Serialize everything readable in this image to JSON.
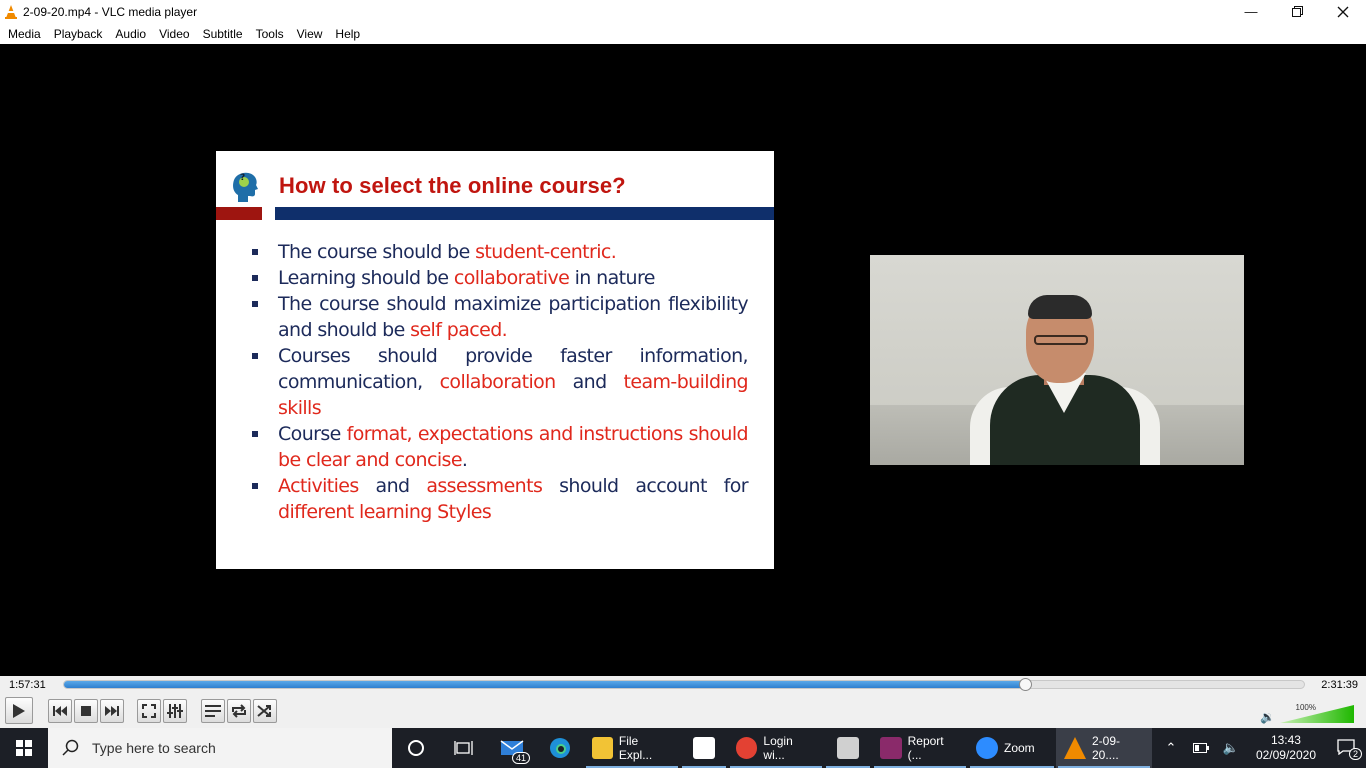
{
  "window": {
    "title": "2-09-20.mp4 - VLC media player",
    "controls": [
      "minimize",
      "restore",
      "close"
    ]
  },
  "menu": [
    "Media",
    "Playback",
    "Audio",
    "Video",
    "Subtitle",
    "Tools",
    "View",
    "Help"
  ],
  "slide": {
    "heading": "How to select the online course?",
    "bullets": [
      [
        {
          "t": "The course should be ",
          "c": "n"
        },
        {
          "t": "student-centric.",
          "c": "r"
        }
      ],
      [
        {
          "t": "Learning should be ",
          "c": "n"
        },
        {
          "t": "collaborative",
          "c": "r"
        },
        {
          "t": " in nature",
          "c": "n"
        }
      ],
      [
        {
          "t": "The course should maximize participation flexibility and should be ",
          "c": "n"
        },
        {
          "t": "self paced.",
          "c": "r"
        }
      ],
      [
        {
          "t": "Courses should provide faster information, communication, ",
          "c": "n"
        },
        {
          "t": "collaboration",
          "c": "r"
        },
        {
          "t": " and ",
          "c": "n"
        },
        {
          "t": "team-building skills",
          "c": "r"
        }
      ],
      [
        {
          "t": "Course ",
          "c": "n"
        },
        {
          "t": "format, expectations and instructions should be clear and concise",
          "c": "r"
        },
        {
          "t": ".",
          "c": "n"
        }
      ],
      [
        {
          "t": "Activities",
          "c": "r"
        },
        {
          "t": " and ",
          "c": "n"
        },
        {
          "t": "assessments",
          "c": "r"
        },
        {
          "t": " should account for ",
          "c": "n"
        },
        {
          "t": "different learning Styles",
          "c": "r"
        }
      ]
    ]
  },
  "player": {
    "elapsed": "1:57:31",
    "total": "2:31:39",
    "progress_fraction": 0.775,
    "volume_label": "100%",
    "volume_fraction": 1.0
  },
  "taskbar": {
    "search_placeholder": "Type here to search",
    "mail_badge": "41",
    "apps": [
      {
        "label": "File Expl...",
        "icon": "folder-icon",
        "color": "#f2c335"
      },
      {
        "label": "",
        "icon": "store-icon",
        "color": "#ffffff"
      },
      {
        "label": "Login wi...",
        "icon": "chrome-icon",
        "color": "#e34133"
      },
      {
        "label": "",
        "icon": "paint-icon",
        "color": "#d0d0d0"
      },
      {
        "label": "Report (...",
        "icon": "winrar-icon",
        "color": "#8a2a6a"
      },
      {
        "label": "Zoom",
        "icon": "zoom-icon",
        "color": "#2d8cff"
      },
      {
        "label": "2-09-20....",
        "icon": "vlc-icon",
        "color": "#f08a00"
      }
    ],
    "time": "13:43",
    "date": "02/09/2020",
    "notifications": "2"
  },
  "colors": {
    "slide_heading": "#c0150f",
    "slide_text": "#1c2a5a",
    "slide_highlight": "#e0281c",
    "seek_fill": "#2f7fcf"
  }
}
